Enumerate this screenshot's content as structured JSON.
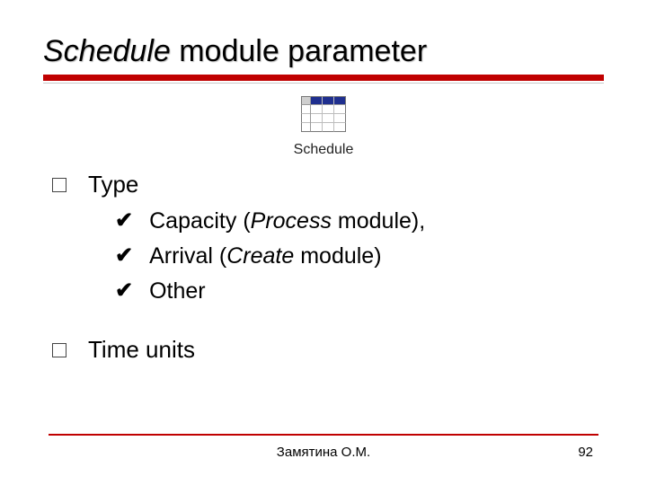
{
  "title": {
    "italic": "Schedule",
    "rest": " module parameter"
  },
  "icon": {
    "caption": "Schedule"
  },
  "bullets": {
    "type": {
      "label": "Type",
      "items": {
        "capacity": {
          "pre": "Capacity (",
          "it": "Process",
          "post": " module),"
        },
        "arrival": {
          "pre": "Arrival (",
          "it": "Create",
          "post": " module)"
        },
        "other": {
          "pre": "Other",
          "it": "",
          "post": ""
        }
      }
    },
    "timeunits": {
      "label": "Time units"
    }
  },
  "footer": {
    "author": "Замятина О.М.",
    "page": "92"
  }
}
